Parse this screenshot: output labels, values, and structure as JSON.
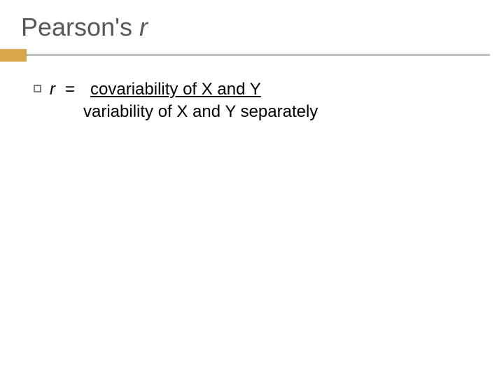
{
  "title": {
    "prefix": "Pearson's ",
    "var": "r"
  },
  "formula": {
    "lhs": "r",
    "equals": "=",
    "numerator": "covariability of X and Y",
    "denominator": "variability of X and Y separately"
  }
}
